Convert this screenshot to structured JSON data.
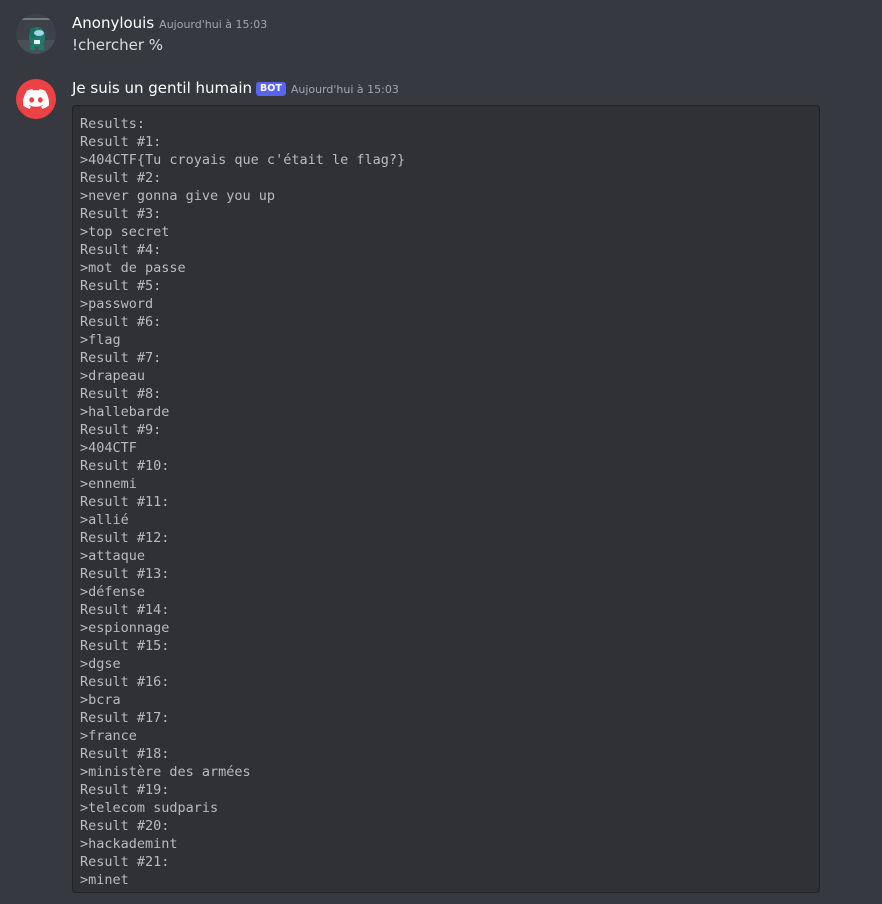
{
  "colors": {
    "background": "#36393f",
    "codeblock_bg": "#2f3136",
    "bot_badge": "#5865f2",
    "bot_avatar": "#ed4245"
  },
  "messages": [
    {
      "author": "Anonylouis",
      "timestamp": "Aujourd'hui à 15:03",
      "avatar_icon": "amongus-avatar-icon",
      "text": "!chercher %"
    },
    {
      "author": "Je suis un gentil humain",
      "badge": "BOT",
      "timestamp": "Aujourd'hui à 15:03",
      "avatar_icon": "discord-logo-icon",
      "code_lines": [
        "Results:",
        "Result #1:",
        ">404CTF{Tu croyais que c'était le flag?}",
        "Result #2:",
        ">never gonna give you up",
        "Result #3:",
        ">top secret",
        "Result #4:",
        ">mot de passe",
        "Result #5:",
        ">password",
        "Result #6:",
        ">flag",
        "Result #7:",
        ">drapeau",
        "Result #8:",
        ">hallebarde",
        "Result #9:",
        ">404CTF",
        "Result #10:",
        ">ennemi",
        "Result #11:",
        ">allié",
        "Result #12:",
        ">attaque",
        "Result #13:",
        ">défense",
        "Result #14:",
        ">espionnage",
        "Result #15:",
        ">dgse",
        "Result #16:",
        ">bcra",
        "Result #17:",
        ">france",
        "Result #18:",
        ">ministère des armées",
        "Result #19:",
        ">telecom sudparis",
        "Result #20:",
        ">hackademint",
        "Result #21:",
        ">minet"
      ]
    }
  ]
}
